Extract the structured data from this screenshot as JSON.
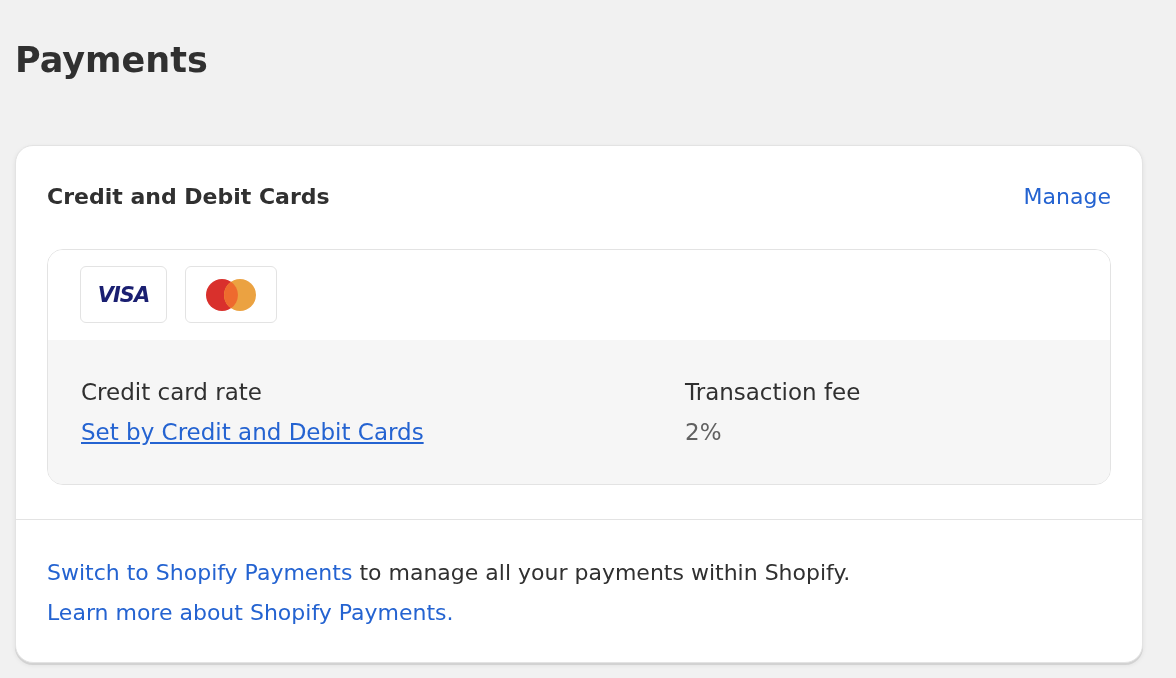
{
  "page": {
    "title": "Payments"
  },
  "card": {
    "title": "Credit and Debit Cards",
    "action": "Manage",
    "brands": [
      {
        "kind": "visa",
        "wordmark": "VISA"
      },
      {
        "kind": "mastercard"
      }
    ],
    "rates": [
      {
        "label": "Credit card rate",
        "value": "Set by Credit and Debit Cards",
        "kind": "link"
      },
      {
        "label": "Transaction fee",
        "value": "2%",
        "kind": "text"
      }
    ],
    "note": [
      {
        "text": "Switch to Shopify Payments",
        "kind": "link"
      },
      {
        "text": "to manage all your payments within Shopify.",
        "kind": "text"
      },
      {
        "text": "Learn more about Shopify Payments.",
        "kind": "link"
      }
    ]
  }
}
